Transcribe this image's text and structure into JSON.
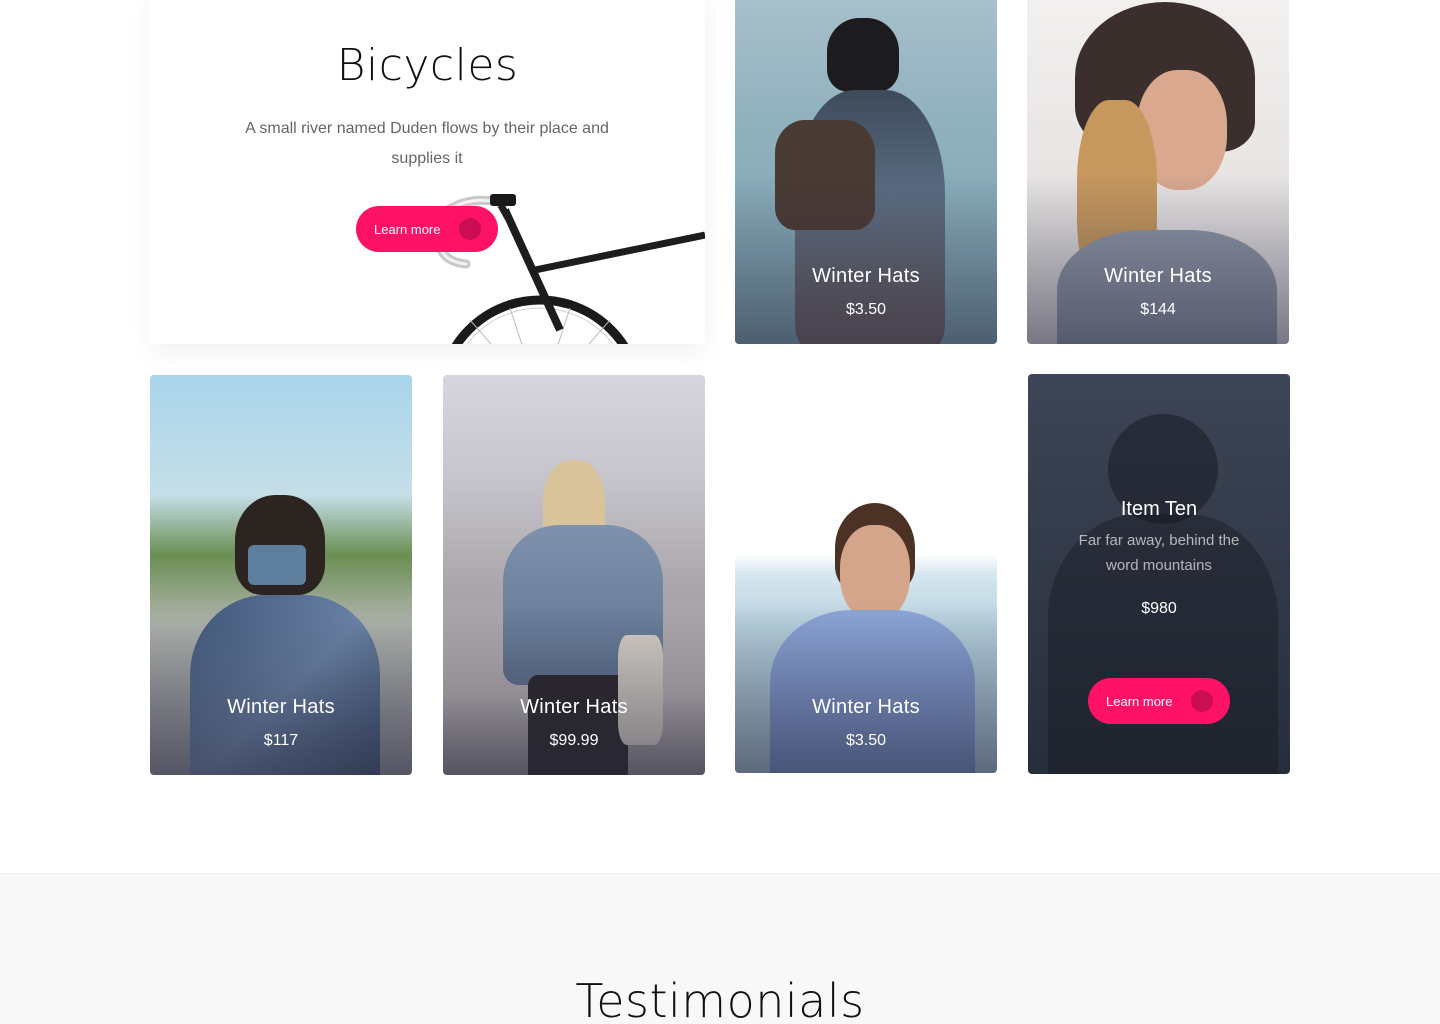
{
  "feature": {
    "title": "Bicycles",
    "text": "A small river named Duden flows by their place and supplies it",
    "button_label": "Learn more"
  },
  "cards": [
    {
      "name": "Winter Hats",
      "price": "$3.50"
    },
    {
      "name": "Winter Hats",
      "price": "$144"
    },
    {
      "name": "Winter Hats",
      "price": "$117"
    },
    {
      "name": "Winter Hats",
      "price": "$99.99"
    },
    {
      "name": "Winter Hats",
      "price": "$3.50"
    }
  ],
  "item_ten": {
    "title": "Item Ten",
    "description": "Far far away, behind the word mountains",
    "price": "$980",
    "button_label": "Learn more"
  },
  "testimonials": {
    "heading": "Testimonials"
  },
  "colors": {
    "accent": "#fe1266",
    "section_bg": "#f8f8f8"
  },
  "icons": {
    "button_arrow": "chevron-right-icon"
  }
}
